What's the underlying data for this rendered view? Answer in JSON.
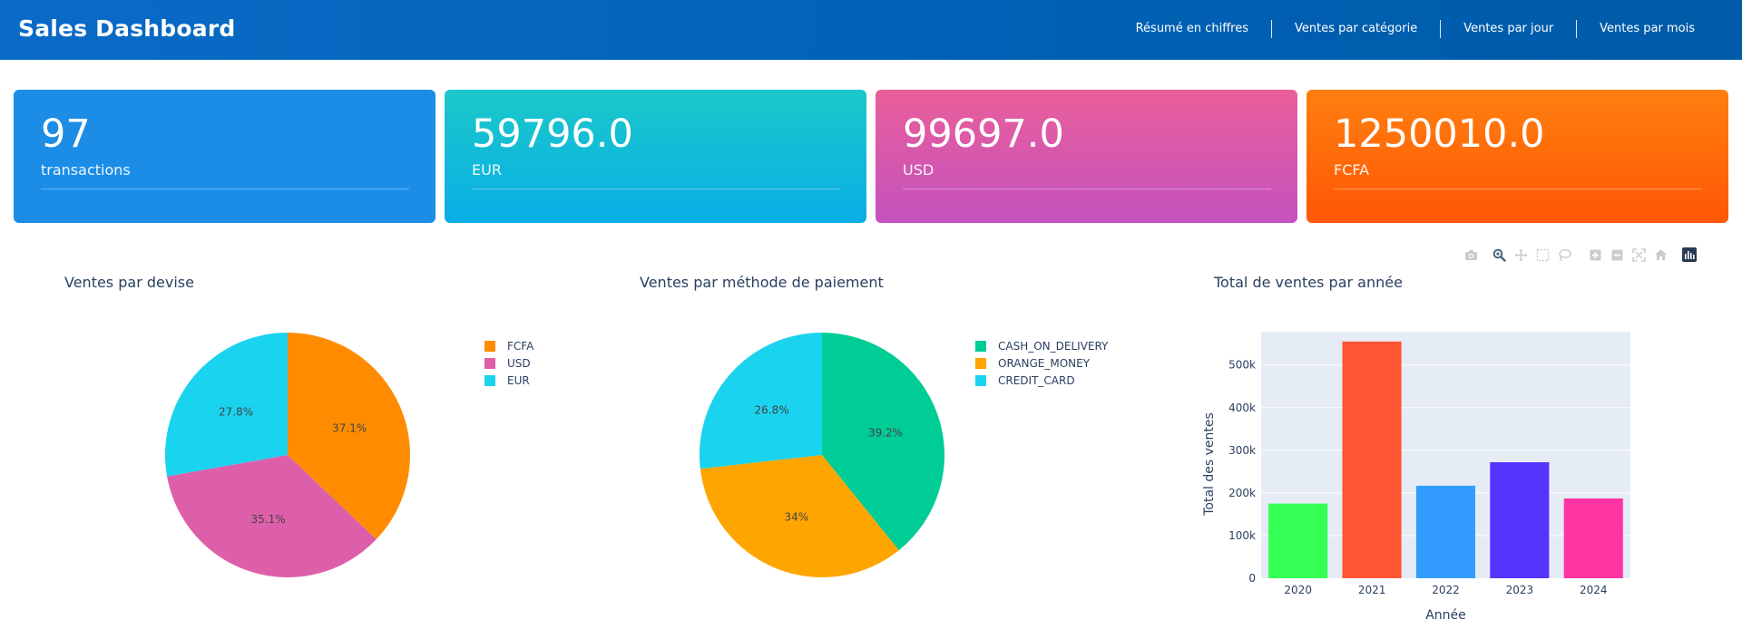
{
  "header": {
    "title": "Sales Dashboard",
    "nav": [
      "Résumé en chiffres",
      "Ventes par catégorie",
      "Ventes par jour",
      "Ventes par mois"
    ]
  },
  "cards": [
    {
      "value": "97",
      "label": "transactions"
    },
    {
      "value": "59796.0",
      "label": "EUR"
    },
    {
      "value": "99697.0",
      "label": "USD"
    },
    {
      "value": "1250010.0",
      "label": "FCFA"
    }
  ],
  "modebar": [
    "camera-icon",
    "zoom-icon",
    "pan-icon",
    "box-select-icon",
    "lasso-icon",
    "zoom-in-icon",
    "zoom-out-icon",
    "autoscale-icon",
    "reset-axes-icon",
    "plotly-logo-icon"
  ],
  "chart_data": [
    {
      "type": "pie",
      "title": "Ventes par devise",
      "labels": [
        "FCFA",
        "USD",
        "EUR"
      ],
      "values": [
        37.1,
        35.1,
        27.8
      ],
      "text": [
        "37.1%",
        "35.1%",
        "27.8%"
      ],
      "colors": [
        "#ff8c00",
        "#de5fa9",
        "#1ad3ef"
      ],
      "legend": "right"
    },
    {
      "type": "pie",
      "title": "Ventes par méthode de paiement",
      "labels": [
        "CASH_ON_DELIVERY",
        "ORANGE_MONEY",
        "CREDIT_CARD"
      ],
      "values": [
        39.2,
        34,
        26.8
      ],
      "text": [
        "39.2%",
        "34%",
        "26.8%"
      ],
      "colors": [
        "#00cc96",
        "#ffa500",
        "#1ad3ef"
      ],
      "legend": "right"
    },
    {
      "type": "bar",
      "title": "Total de ventes par année",
      "categories": [
        "2020",
        "2021",
        "2022",
        "2023",
        "2024"
      ],
      "values": [
        175000,
        555000,
        217000,
        272000,
        187000
      ],
      "colors": [
        "#33ff55",
        "#ff5533",
        "#339dff",
        "#5733ff",
        "#ff33a1"
      ],
      "xlabel": "Année",
      "ylabel": "Total des ventes",
      "ylim": [
        0,
        578000
      ],
      "yticks": [
        0,
        100000,
        200000,
        300000,
        400000,
        500000
      ],
      "ytick_labels": [
        "0",
        "100k",
        "200k",
        "300k",
        "400k",
        "500k"
      ],
      "grid": true
    }
  ]
}
